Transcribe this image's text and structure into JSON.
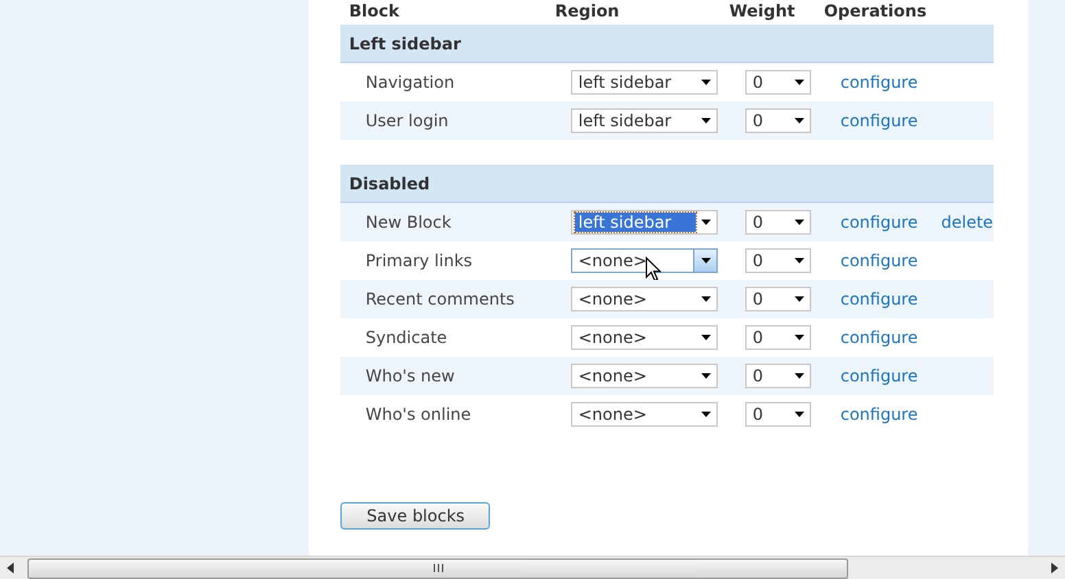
{
  "table": {
    "columns": [
      "Block",
      "Region",
      "Weight",
      "Operations"
    ],
    "groups": [
      {
        "title": "Left sidebar",
        "rows": [
          {
            "block": "Navigation",
            "shaded": false,
            "region": {
              "value": "left sidebar",
              "highlighted": false,
              "hovered": false
            },
            "weight": "0",
            "operations": [
              "configure"
            ]
          },
          {
            "block": "User login",
            "shaded": true,
            "region": {
              "value": "left sidebar",
              "highlighted": false,
              "hovered": false
            },
            "weight": "0",
            "operations": [
              "configure"
            ]
          }
        ]
      },
      {
        "title": "Disabled",
        "rows": [
          {
            "block": "New Block",
            "shaded": true,
            "region": {
              "value": "left sidebar",
              "highlighted": true,
              "hovered": false
            },
            "weight": "0",
            "operations": [
              "configure",
              "delete"
            ]
          },
          {
            "block": "Primary links",
            "shaded": false,
            "region": {
              "value": "<none>",
              "highlighted": false,
              "hovered": true
            },
            "weight": "0",
            "operations": [
              "configure"
            ]
          },
          {
            "block": "Recent comments",
            "shaded": true,
            "region": {
              "value": "<none>",
              "highlighted": false,
              "hovered": false
            },
            "weight": "0",
            "operations": [
              "configure"
            ]
          },
          {
            "block": "Syndicate",
            "shaded": false,
            "region": {
              "value": "<none>",
              "highlighted": false,
              "hovered": false
            },
            "weight": "0",
            "operations": [
              "configure"
            ]
          },
          {
            "block": "Who's new",
            "shaded": true,
            "region": {
              "value": "<none>",
              "highlighted": false,
              "hovered": false
            },
            "weight": "0",
            "operations": [
              "configure"
            ]
          },
          {
            "block": "Who's online",
            "shaded": false,
            "region": {
              "value": "<none>",
              "highlighted": false,
              "hovered": false
            },
            "weight": "0",
            "operations": [
              "configure"
            ]
          }
        ]
      }
    ]
  },
  "save_button": "Save blocks"
}
